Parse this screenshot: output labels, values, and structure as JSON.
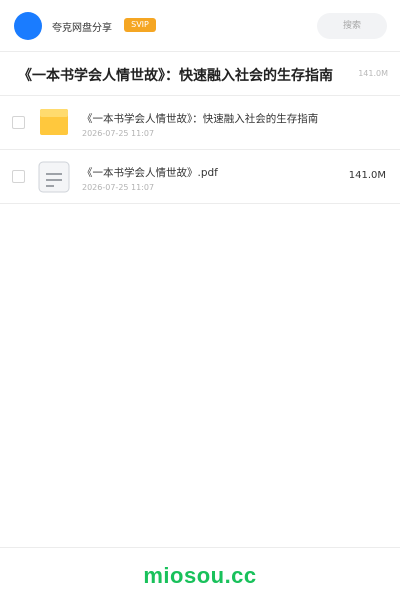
{
  "header": {
    "app_name": "夸克网盘分享",
    "badge": "SVIP",
    "search_placeholder": "搜索",
    "accent_color": "#1a7cff"
  },
  "share": {
    "title": "《一本书学会人情世故》：快速融入社会的生存指南",
    "size": "141.0M"
  },
  "files": [
    {
      "name": "《一本书学会人情世故》：快速融入社会的生存指南",
      "date": "2026-07-25 11:07",
      "size": "",
      "icon": "folder-icon"
    },
    {
      "name": "《一本书学会人情世故》.pdf",
      "date": "2026-07-25 11:07",
      "size": "141.0M",
      "icon": "document-icon"
    }
  ],
  "footer": {
    "brand": "miosou.cc",
    "brand_color": "#19c15b"
  }
}
